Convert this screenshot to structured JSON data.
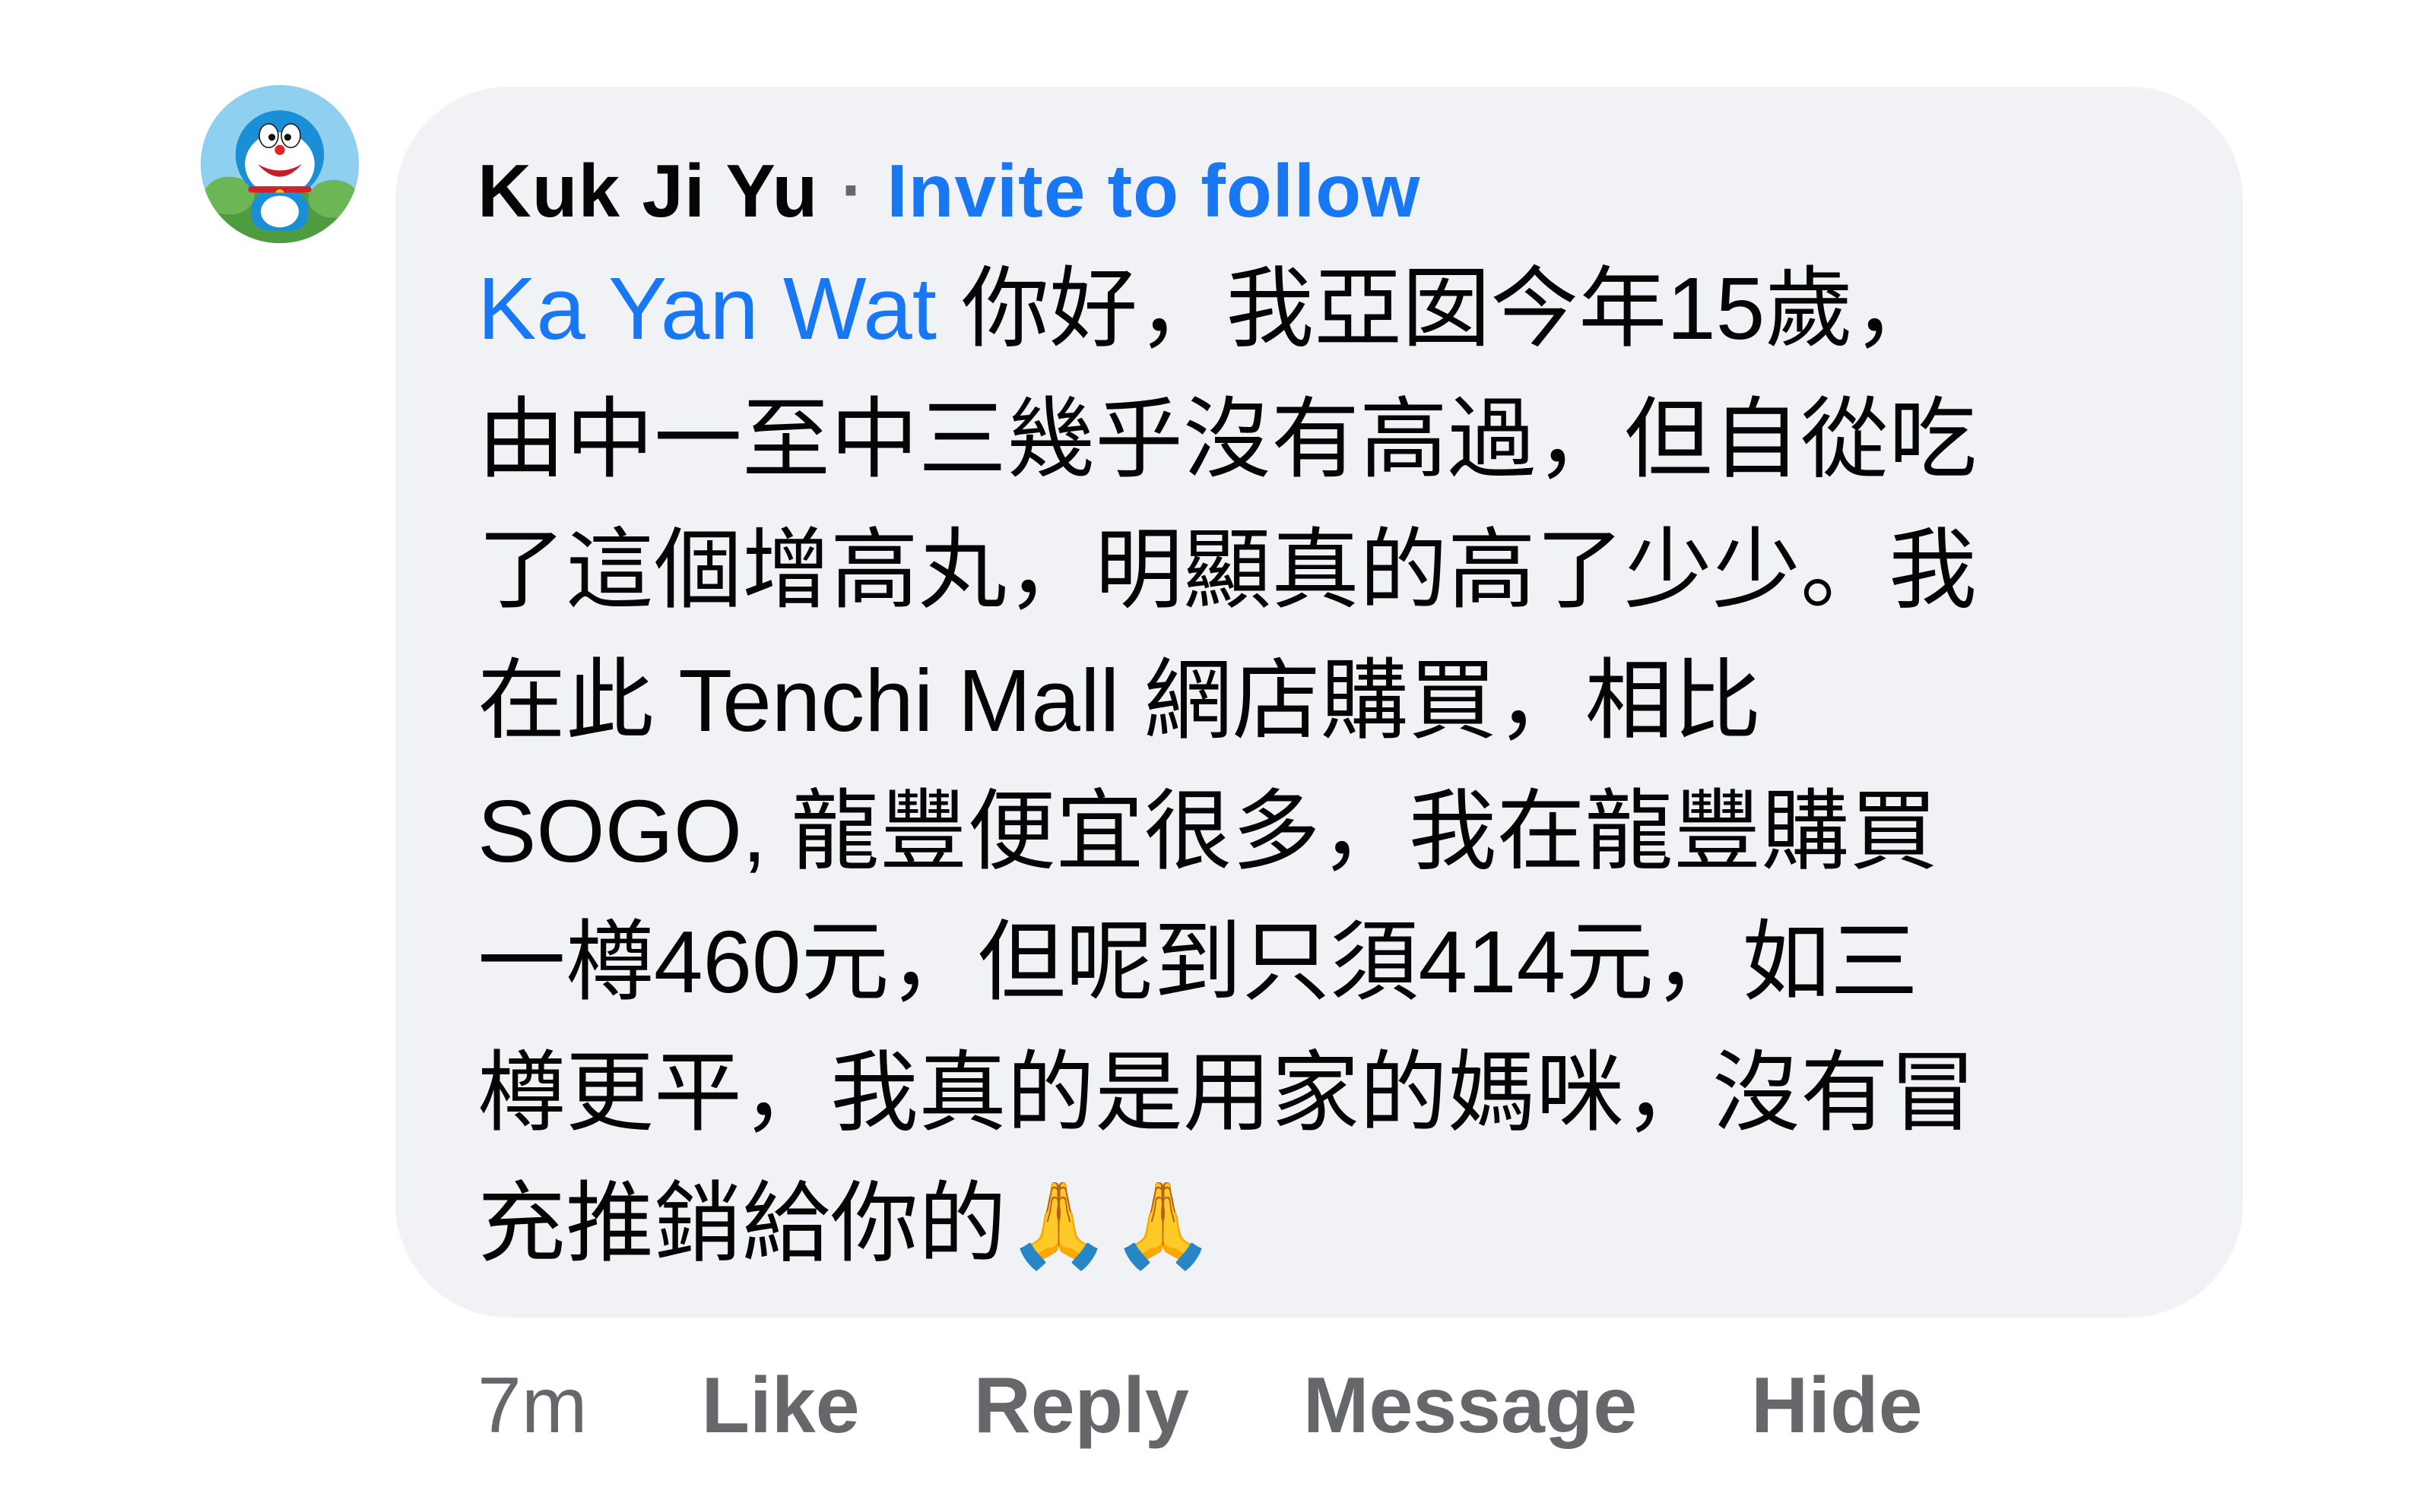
{
  "comment": {
    "author": "Kuk Ji Yu",
    "separator": "·",
    "invite_label": "Invite to follow",
    "mention": "Ka Yan Wat",
    "lines": [
      " 你好，我亞囡今年15歲，",
      "由中一至中三幾乎沒有高過，但自從吃",
      "了這個增高丸，明顯真的高了少少。我",
      "在此 Tenchi Mall 網店購買，相比",
      "SOGO, 龍豐便宜很多，我在龍豐購買",
      "一樽460元，但呢到只須414元，如三",
      "樽更平，我真的是用家的媽咪，沒有冒",
      "充推銷給你的"
    ],
    "emoji": "🙏🙏",
    "avatar_icon": "doraemon-avatar-icon"
  },
  "actions": {
    "time": "7m",
    "like": "Like",
    "reply": "Reply",
    "message": "Message",
    "hide": "Hide"
  },
  "colors": {
    "bubble": "#f0f2f5",
    "link": "#1877f2",
    "text": "#050505",
    "meta": "#65676b"
  }
}
